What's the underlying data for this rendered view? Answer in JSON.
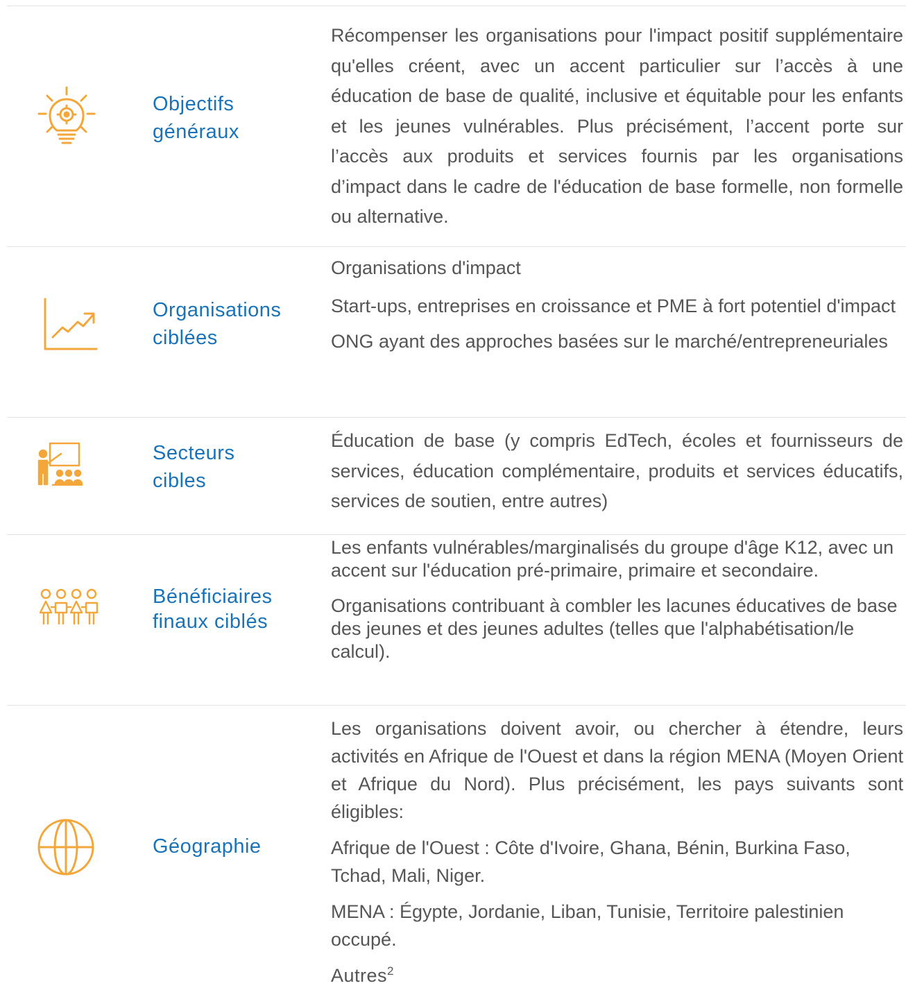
{
  "rows": [
    {
      "icon": "lightbulb-gear-icon",
      "label_line1": "Objectifs",
      "label_line2": "généraux",
      "paragraphs": [
        "Récompenser les organisations pour l'impact positif supplémentaire qu'elles créent, avec un accent particulier sur l’accès à une éducation de base de qualité, inclusive et équitable pour les enfants et les jeunes vulnérables. Plus précisément, l’accent porte sur l’accès aux produits et services fournis par les organisations d’impact dans le cadre de l'éducation de base formelle, non formelle ou alternative."
      ]
    },
    {
      "icon": "growth-chart-icon",
      "label_line1": "Organisations",
      "label_line2": "ciblées",
      "paragraphs": [
        "Organisations d'impact",
        "Start-ups, entreprises en croissance et PME à fort potentiel d'impact",
        "ONG ayant des approches basées sur le marché/entrepreneuriales"
      ]
    },
    {
      "icon": "teacher-classroom-icon",
      "label_line1": "Secteurs",
      "label_line2": "cibles",
      "paragraphs": [
        "Éducation de base (y compris EdTech, écoles et fournisseurs de services, éducation complémentaire, produits et services éducatifs, services de soutien, entre autres)"
      ]
    },
    {
      "icon": "children-group-icon",
      "label_line1": "Bénéficiaires",
      "label_line2": "finaux ciblés",
      "paragraphs": [
        "Les enfants vulnérables/marginalisés du groupe d'âge K12, avec un accent sur l'éducation pré-primaire, primaire et secondaire.",
        "Organisations contribuant à combler les lacunes éducatives de base des jeunes et des jeunes adultes (telles que l'alphabétisation/le calcul)."
      ]
    },
    {
      "icon": "globe-icon",
      "label_line1": "Géographie",
      "paragraphs": [
        "Les organisations doivent avoir, ou chercher à étendre, leurs activités en Afrique de l'Ouest et dans la région MENA (Moyen Orient et Afrique du Nord). Plus précisément, les pays suivants sont éligibles:",
        "Afrique de l'Ouest : Côte d'Ivoire, Ghana, Bénin, Burkina Faso, Tchad, Mali, Niger.",
        "MENA : Égypte, Jordanie, Liban, Tunisie, Territoire palestinien occupé.",
        "Autres"
      ],
      "footnote": "2"
    }
  ],
  "colors": {
    "icon": "#f3a73b",
    "label": "#1a73b8",
    "text": "#555555",
    "rule": "#e2e2e2"
  }
}
